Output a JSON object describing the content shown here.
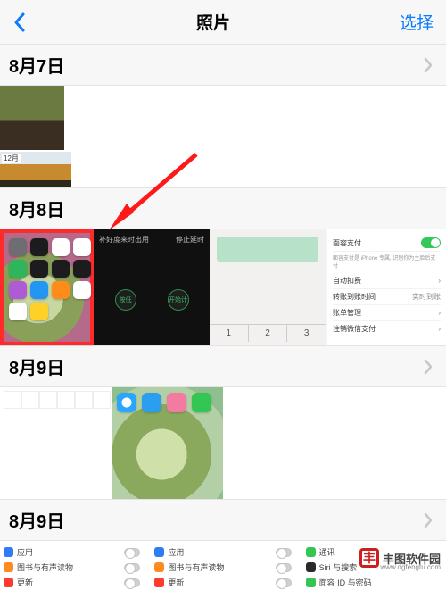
{
  "nav": {
    "title": "照片",
    "select": "选择"
  },
  "sections": {
    "d1": "8月7日",
    "d2": "8月8日",
    "d3": "8月9日",
    "d4": "8月9日",
    "badge12": "12月"
  },
  "black": {
    "title": "补好度来时出用",
    "right": "停止延时",
    "c1": "按低",
    "c2": "开始计"
  },
  "mint": {
    "t1": "1",
    "t2": "2",
    "t3": "3"
  },
  "settings": {
    "r1": "面容支付",
    "r1d": "面容支付是 iPhone 专属, 识别你为主脸后支付",
    "r2": "自动扣费",
    "r3": "转账到账时间",
    "r3v": "实时到账",
    "r4": "账单管理",
    "r5": "注销微信支付"
  },
  "bottom": {
    "a1": "应用",
    "a2": "图书与有声读物",
    "a3": "更新",
    "b1": "应用",
    "b2": "图书与有声读物",
    "b3": "更新",
    "c1": "通讯",
    "c2": "Siri 与搜索",
    "c3": "面容 ID 与密码"
  },
  "watermark": {
    "name": "丰图软件园",
    "url": "www.dgfengtu.com"
  }
}
